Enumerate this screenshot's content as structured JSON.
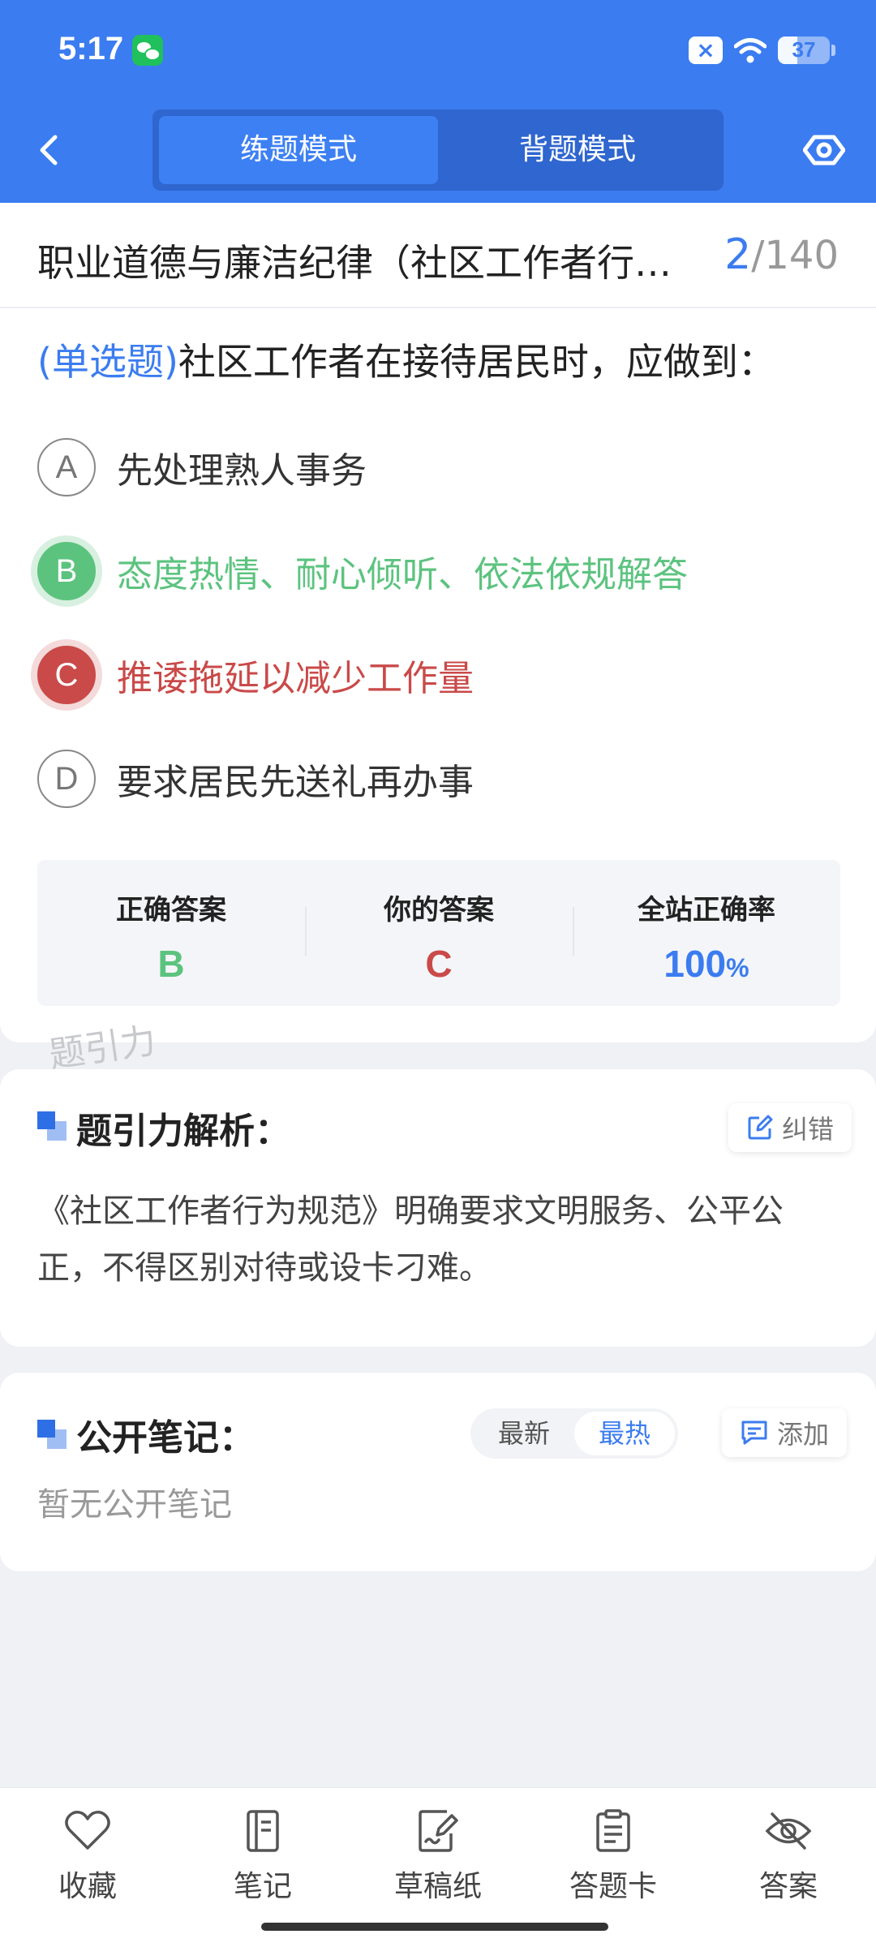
{
  "status_bar": {
    "time": "5:17",
    "battery_level": "37",
    "battery_fraction": 0.37
  },
  "header": {
    "tabs": [
      {
        "label": "练题模式",
        "active": true
      },
      {
        "label": "背题模式",
        "active": false
      }
    ]
  },
  "question_header": {
    "chapter_title": "职业道德与廉洁纪律（社区工作者行…",
    "current": "2",
    "total": "/140"
  },
  "question": {
    "type_label": "(单选题)",
    "text": "社区工作者在接待居民时，应做到：",
    "options": [
      {
        "letter": "A",
        "text": "先处理熟人事务",
        "state": "normal"
      },
      {
        "letter": "B",
        "text": "态度热情、耐心倾听、依法依规解答",
        "state": "correct"
      },
      {
        "letter": "C",
        "text": "推诿拖延以减少工作量",
        "state": "wrong"
      },
      {
        "letter": "D",
        "text": "要求居民先送礼再办事",
        "state": "normal"
      }
    ]
  },
  "answer_summary": {
    "correct_label": "正确答案",
    "correct_value": "B",
    "yours_label": "你的答案",
    "yours_value": "C",
    "rate_label": "全站正确率",
    "rate_value": "100",
    "rate_unit": "%"
  },
  "watermark": "题引力",
  "analysis": {
    "title": "题引力解析：",
    "report_label": "纠错",
    "text": "《社区工作者行为规范》明确要求文明服务、公平公正，不得区别对待或设卡刁难。"
  },
  "notes": {
    "title": "公开笔记：",
    "sort_options": [
      {
        "label": "最新",
        "active": false
      },
      {
        "label": "最热",
        "active": true
      }
    ],
    "add_label": "添加",
    "empty_text": "暂无公开笔记"
  },
  "bottom_bar": {
    "items": [
      {
        "label": "收藏",
        "icon": "heart-icon"
      },
      {
        "label": "笔记",
        "icon": "notebook-icon"
      },
      {
        "label": "草稿纸",
        "icon": "draft-icon"
      },
      {
        "label": "答题卡",
        "icon": "answer-card-icon"
      },
      {
        "label": "答案",
        "icon": "eye-off-icon"
      }
    ]
  },
  "colors": {
    "primary": "#3b7cf0",
    "correct": "#5cc37f",
    "wrong": "#c94a49"
  }
}
